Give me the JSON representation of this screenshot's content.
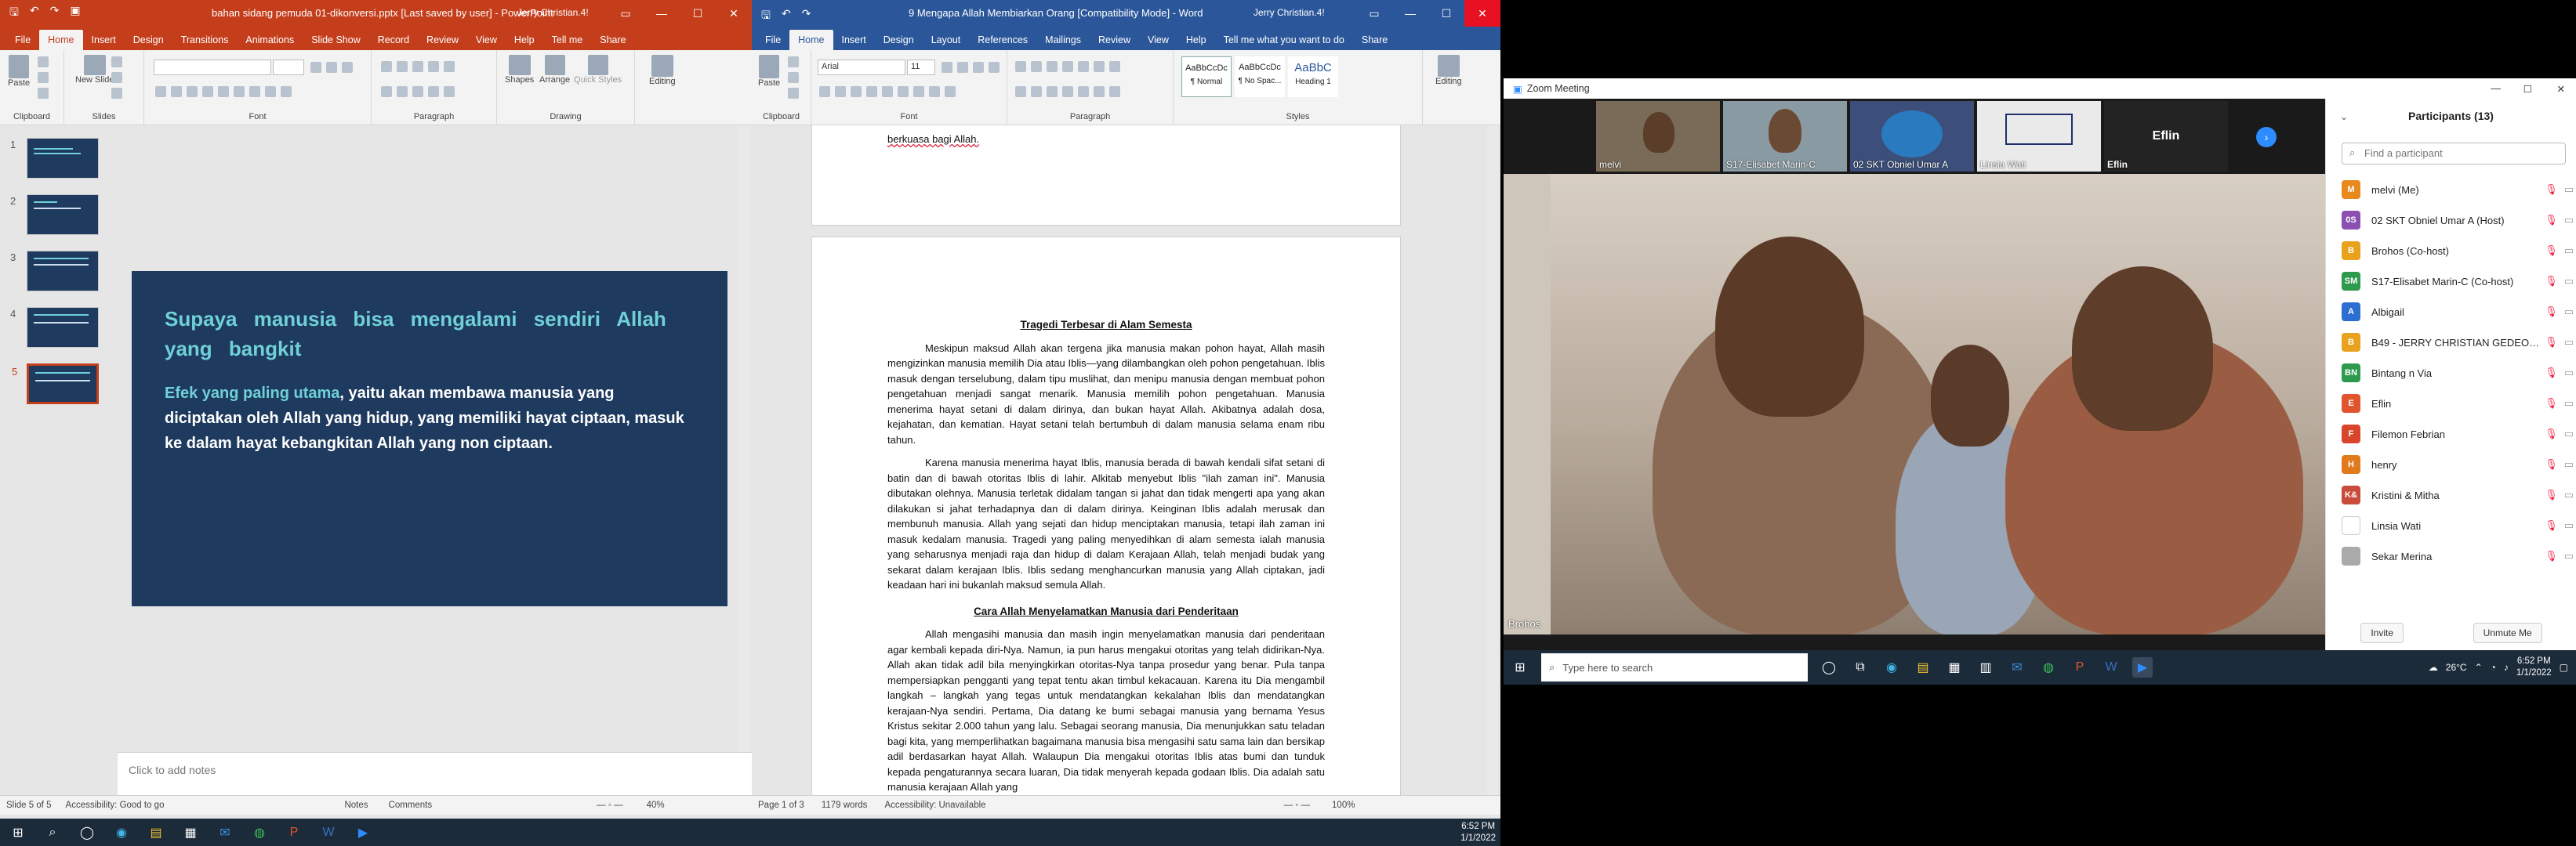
{
  "powerpoint": {
    "title": "bahan sidang pemuda 01-dikonversi.pptx [Last saved by user] - PowerPoint",
    "user": "Jerry Christian.4!",
    "tabs": [
      "File",
      "Home",
      "Insert",
      "Design",
      "Transitions",
      "Animations",
      "Slide Show",
      "Record",
      "Review",
      "View",
      "Help",
      "Tell me",
      "Share"
    ],
    "active_tab": "Home",
    "groups": {
      "clipboard": "Clipboard",
      "slides": "Slides",
      "font": "Font",
      "paragraph": "Paragraph",
      "drawing": "Drawing"
    },
    "buttons": {
      "paste": "Paste",
      "new_slide": "New Slide",
      "shapes": "Shapes",
      "arrange": "Arrange",
      "quick_styles": "Quick Styles",
      "editing": "Editing"
    },
    "thumbnails": [
      "1",
      "2",
      "3",
      "4",
      "5"
    ],
    "selected_slide": 5,
    "slide": {
      "heading": "Supaya manusia bisa mengalami sendiri Allah yang bangkit",
      "accent": "Efek yang paling utama",
      "body": ", yaitu akan membawa manusia yang diciptakan oleh Allah yang hidup, yang memiliki hayat ciptaan, masuk ke dalam hayat kebangkitan Allah yang non ciptaan."
    },
    "notes_placeholder": "Click to add notes",
    "status": {
      "slide": "Slide 5 of 5",
      "accessibility": "Accessibility: Good to go",
      "notes": "Notes",
      "comments": "Comments",
      "zoom": "40%"
    }
  },
  "word": {
    "title": "9 Mengapa Allah Membiarkan Orang [Compatibility Mode] - Word",
    "user": "Jerry Christian.4!",
    "tabs": [
      "File",
      "Home",
      "Insert",
      "Design",
      "Layout",
      "References",
      "Mailings",
      "Review",
      "View",
      "Help",
      "Tell me what you want to do",
      "Share"
    ],
    "active_tab": "Home",
    "font": "Arial",
    "size": "11",
    "styles": [
      "AaBbCcDc",
      "AaBbCcDc",
      "AaBbC"
    ],
    "style_names": [
      "¶ Normal",
      "¶ No Spac...",
      "Heading 1"
    ],
    "groups": {
      "clipboard": "Clipboard",
      "font": "Font",
      "paragraph": "Paragraph",
      "styles": "Styles",
      "editing": "Editing"
    },
    "paste": "Paste",
    "editing": "Editing",
    "prev_page_tail": "berkuasa bagi Allah.",
    "heading1": "Tragedi Terbesar di Alam Semesta",
    "p1": "Meskipun maksud Allah akan tergena jika manusia makan pohon hayat, Allah masih mengizinkan manusia memilih Dia atau Iblis—yang dilambangkan oleh pohon pengetahuan. Iblis masuk dengan terselubung, dalam tipu muslihat, dan menipu manusia dengan membuat pohon pengetahuan menjadi sangat menarik. Manusia memilih pohon pengetahuan. Manusia menerima hayat setani di dalam dirinya, dan bukan hayat Allah. Akibatnya adalah dosa, kejahatan, dan kematian. Hayat setani telah bertumbuh di dalam manusia selama enam ribu tahun.",
    "p2": "Karena manusia menerima hayat Iblis, manusia berada di bawah kendali sifat setani di batin dan di bawah otoritas Iblis di lahir. Alkitab menyebut Iblis \"ilah zaman ini\". Manusia dibutakan olehnya. Manusia terletak didalam tangan si jahat dan tidak mengerti apa yang akan dilakukan si jahat terhadapnya dan di dalam dirinya. Keinginan Iblis adalah merusak dan membunuh manusia. Allah yang sejati dan hidup menciptakan manusia, tetapi ilah zaman ini masuk kedalam manusia. Tragedi yang paling menyedihkan di alam semesta ialah manusia yang seharusnya menjadi raja dan hidup di dalam Kerajaan Allah, telah menjadi budak yang sekarat dalam kerajaan Iblis. Iblis sedang menghancurkan manusia yang Allah ciptakan, jadi keadaan hari ini bukanlah maksud semula Allah.",
    "heading2": "Cara Allah Menyelamatkan Manusia dari Penderitaan",
    "p3": "Allah mengasihi manusia dan masih ingin menyelamatkan manusia dari penderitaan agar kembali kepada diri-Nya. Namun, ia pun harus mengakui otoritas yang telah didirikan-Nya. Allah akan tidak adil bila menyingkirkan otoritas-Nya tanpa prosedur yang benar. Pula tanpa mempersiapkan pengganti yang tepat tentu akan timbul kekacauan. Karena itu Dia mengambil langkah – langkah yang tegas untuk mendatangkan kekalahan Iblis dan mendatangkan kerajaan-Nya sendiri. Pertama, Dia datang ke bumi sebagai manusia yang bernama Yesus Kristus sekitar 2.000 tahun yang lalu. Sebagai seorang manusia, Dia menunjukkan satu teladan bagi kita, yang memperlihatkan bagaimana manusia bisa mengasihi satu sama lain dan bersikap adil berdasarkan hayat Allah. Walaupun Dia mengakui otoritas Iblis atas bumi dan tunduk kepada pengaturannya secara luaran, Dia tidak menyerah kepada godaan Iblis. Dia adalah satu manusia kerajaan Allah yang",
    "status": {
      "page": "Page 1 of 3",
      "words": "1179 words",
      "accessibility": "Accessibility: Unavailable",
      "zoom": "100%"
    }
  },
  "zoom": {
    "title": "Zoom Meeting",
    "gallery": [
      "melvi",
      "S17-Elisabet Marin-C",
      "02 SKT Obniel Umar A",
      "Linsia Wati",
      "Eflin"
    ],
    "active_speaker": "Brohos",
    "participants_header": "Participants (13)",
    "search_placeholder": "Find a participant",
    "participants": [
      {
        "initials": "M",
        "name": "melvi (Me)",
        "color": "#e8891d"
      },
      {
        "initials": "0S",
        "name": "02 SKT Obniel Umar A (Host)",
        "color": "#8a4fb0"
      },
      {
        "initials": "B",
        "name": "Brohos (Co-host)",
        "color": "#e8a21d"
      },
      {
        "initials": "SM",
        "name": "S17-Elisabet Marin-C (Co-host)",
        "color": "#2e9a4e"
      },
      {
        "initials": "A",
        "name": "Albigail",
        "color": "#2d6fd1"
      },
      {
        "initials": "B",
        "name": "B49 - JERRY CHRISTIAN GEDEON...",
        "color": "#e8a21d"
      },
      {
        "initials": "BN",
        "name": "Bintang n Via",
        "color": "#2e9a4e"
      },
      {
        "initials": "E",
        "name": "Eflin",
        "color": "#e2542d"
      },
      {
        "initials": "F",
        "name": "Filemon Febrian",
        "color": "#d9452b"
      },
      {
        "initials": "H",
        "name": "henry",
        "color": "#e07a1d"
      },
      {
        "initials": "K&",
        "name": "Kristini & Mitha",
        "color": "#c94b3c"
      },
      {
        "initials": "",
        "name": "Linsia Wati",
        "color": "#ffffff"
      },
      {
        "initials": "",
        "name": "Sekar Merina",
        "color": "#aaaaaa"
      }
    ],
    "invite": "Invite",
    "unmute_me": "Unmute Me"
  },
  "taskbar_right": {
    "search_placeholder": "Type here to search",
    "weather": "26°C",
    "time": "6:52 PM",
    "date": "1/1/2022"
  },
  "taskbar_left": {
    "time": "6:52 PM",
    "date": "1/1/2022"
  }
}
